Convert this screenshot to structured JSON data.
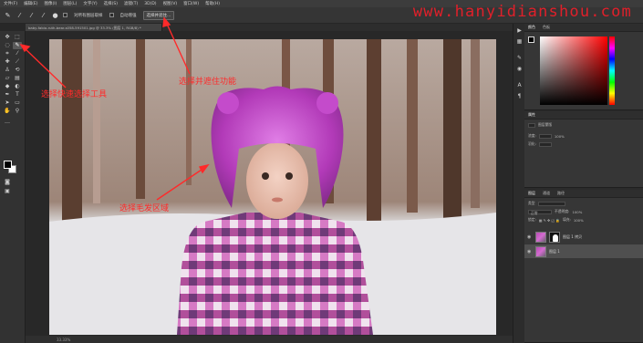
{
  "menubar": {
    "items": [
      "文件(F)",
      "编辑(E)",
      "图像(I)",
      "图层(L)",
      "文字(Y)",
      "选择(S)",
      "滤镜(T)",
      "3D(D)",
      "视图(V)",
      "窗口(W)",
      "帮助(H)"
    ],
    "watermark": "www.hanyidianshou.com"
  },
  "options_bar": {
    "sample_all_layers": "对所有图层取样",
    "auto_enhance": "自动增强",
    "select_and_mask": "选择并遮住...",
    "icons": [
      "brush-tool-icon",
      "new-selection-icon",
      "add-selection-icon",
      "subtract-selection-icon",
      "brush-size-icon"
    ]
  },
  "document": {
    "tab_title": "baby-fabio-ruth-bear-s058-591501.jpg @ 33.3% (图层 1, RGB/8) *",
    "zoom": "33.33%"
  },
  "toolbar": {
    "tools": [
      "move-tool-icon",
      "marquee-tool-icon",
      "lasso-tool-icon",
      "quick-selection-tool-icon",
      "crop-tool-icon",
      "eyedropper-tool-icon",
      "healing-brush-icon",
      "brush-tool-icon",
      "clone-stamp-icon",
      "history-brush-icon",
      "eraser-tool-icon",
      "gradient-tool-icon",
      "blur-tool-icon",
      "dodge-tool-icon",
      "pen-tool-icon",
      "type-tool-icon",
      "path-selection-icon",
      "shape-tool-icon",
      "hand-tool-icon",
      "zoom-tool-icon"
    ],
    "active_tool": "quick-selection-tool-icon",
    "foreground_color": "#000000",
    "background_color": "#ffffff"
  },
  "color_panel": {
    "tabs": [
      "颜色",
      "色板"
    ],
    "active_tab": "颜色"
  },
  "properties_panel": {
    "title": "属性",
    "row1": "图层蒙版",
    "row2": "浓度:",
    "row2_value": "100%",
    "row3": "羽化:"
  },
  "layers_panel": {
    "tabs": [
      "图层",
      "通道",
      "路径"
    ],
    "active_tab": "图层",
    "kind_label": "类型",
    "blend_mode": "正常",
    "opacity_label": "不透明度:",
    "opacity_value": "100%",
    "lock_label": "锁定:",
    "fill_label": "填充:",
    "fill_value": "100%",
    "layers": [
      {
        "name": "图层 1 拷贝",
        "selected": false,
        "has_mask": true
      },
      {
        "name": "图层 1",
        "selected": true,
        "has_mask": false
      }
    ]
  },
  "annotations": {
    "choose_tool": "选择快速选择工具",
    "choose_feature": "选择并遮住功能",
    "select_hair": "选择毛发区域",
    "color": "#ff2a2a"
  }
}
